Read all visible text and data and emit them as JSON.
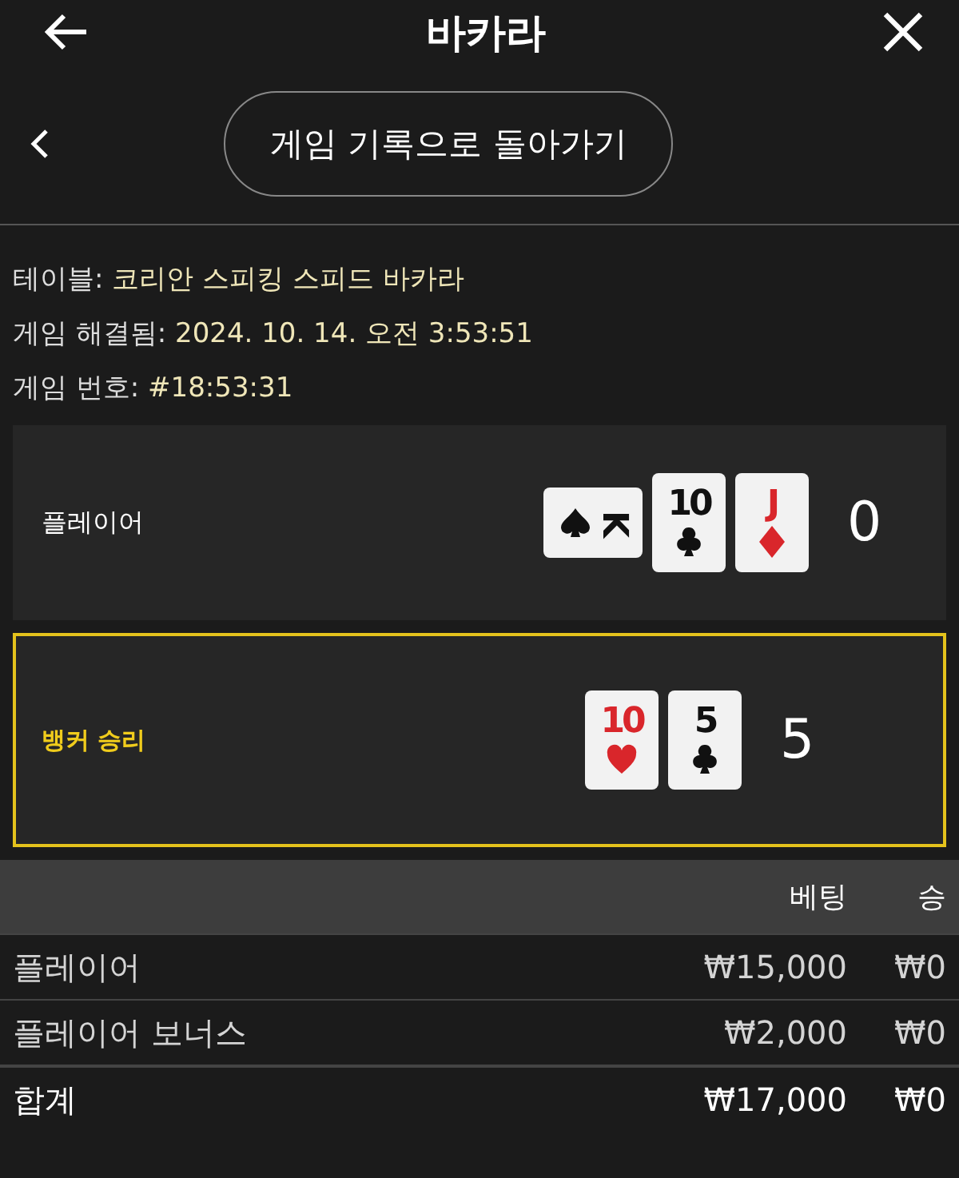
{
  "header": {
    "title": "바카라"
  },
  "nav": {
    "back_label": "게임 기록으로 돌아가기"
  },
  "info": [
    {
      "label": "테이블:",
      "value": "코리안 스피킹 스피드 바카라"
    },
    {
      "label": "게임 해결됨:",
      "value": "2024. 10. 14. 오전 3:53:51"
    },
    {
      "label": "게임 번호:",
      "value": "#18:53:31"
    }
  ],
  "hands": [
    {
      "label": "플레이어",
      "winner": false,
      "score": "0",
      "cards": [
        {
          "rank": "K",
          "kind": "spade",
          "rotated": true
        },
        {
          "rank": "10",
          "kind": "club",
          "rotated": false
        },
        {
          "rank": "J",
          "kind": "diamond",
          "rotated": false
        }
      ]
    },
    {
      "label": "뱅커 승리",
      "winner": true,
      "score": "5",
      "cards": [
        {
          "rank": "10",
          "kind": "heart",
          "rotated": false
        },
        {
          "rank": "5",
          "kind": "club",
          "rotated": false
        }
      ]
    }
  ],
  "table": {
    "columns": [
      "베팅",
      "승"
    ],
    "rows": [
      {
        "kind": "bet",
        "name": "플레이어",
        "bet": "₩15,000",
        "win": "₩0"
      },
      {
        "kind": "bet",
        "name": "플레이어 보너스",
        "bet": "₩2,000",
        "win": "₩0"
      },
      {
        "kind": "total",
        "name": "합계",
        "bet": "₩17,000",
        "win": "₩0"
      }
    ]
  }
}
